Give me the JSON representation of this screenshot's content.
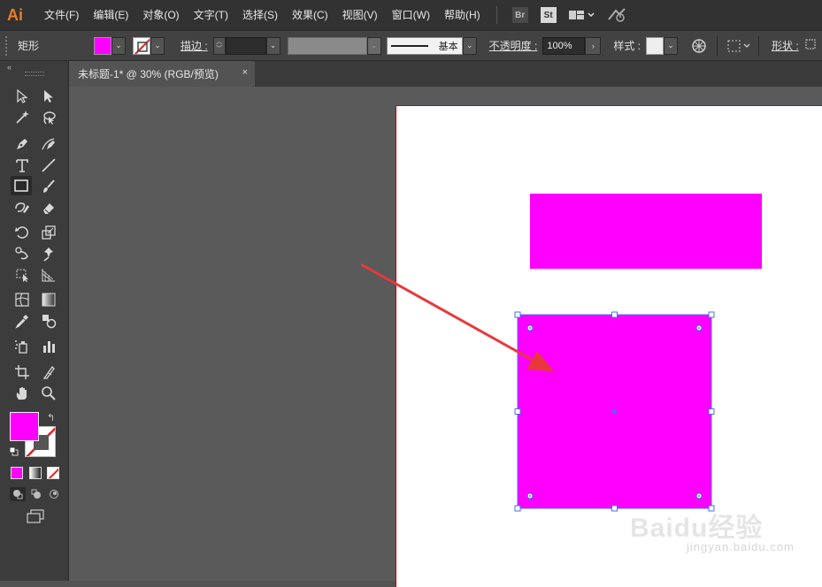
{
  "app": {
    "logo": "Ai",
    "brand_color": "#f07c22"
  },
  "menu": [
    "文件(F)",
    "编辑(E)",
    "对象(O)",
    "文字(T)",
    "选择(S)",
    "效果(C)",
    "视图(V)",
    "窗口(W)",
    "帮助(H)"
  ],
  "menu_icons": {
    "bridge": "Br",
    "stock": "St",
    "workspace": "workspace-switcher-icon",
    "gpu": "gpu-performance-icon"
  },
  "control": {
    "object_type": "矩形",
    "fill_color": "#ff00ff",
    "stroke_label": "描边 :",
    "stroke_value": "",
    "profile_label": "基本",
    "opacity_label": "不透明度 :",
    "opacity_value": "100%",
    "style_label": "样式 :",
    "shape_label": "形状 :"
  },
  "document": {
    "tab_title": "未标题-1* @ 30% (RGB/预览)",
    "close": "×"
  },
  "canvas": {
    "fill_color": "#ff00ff",
    "selection_color": "#4a6cf7",
    "arrow_color": "#e8383c"
  },
  "tools": {
    "fill_color": "#ff00ff",
    "stroke_color": "none",
    "icons": [
      "selection-tool-icon",
      "direct-selection-tool-icon",
      "magic-wand-icon",
      "lasso-icon",
      "pen-tool-icon",
      "curvature-tool-icon",
      "type-tool-icon",
      "line-tool-icon",
      "rectangle-tool-icon",
      "paintbrush-icon",
      "shaper-tool-icon",
      "eraser-icon",
      "rotate-tool-icon",
      "scale-tool-icon",
      "warp-tool-icon",
      "puppet-warp-icon",
      "free-transform-icon",
      "perspective-grid-icon",
      "mesh-tool-icon",
      "gradient-tool-icon",
      "eyedropper-icon",
      "blend-tool-icon",
      "symbol-sprayer-icon",
      "column-graph-icon",
      "artboard-tool-icon",
      "slice-tool-icon",
      "hand-tool-icon",
      "zoom-tool-icon"
    ]
  },
  "watermark": {
    "logo": "Baidu经验",
    "url": "jingyan.baidu.com"
  }
}
